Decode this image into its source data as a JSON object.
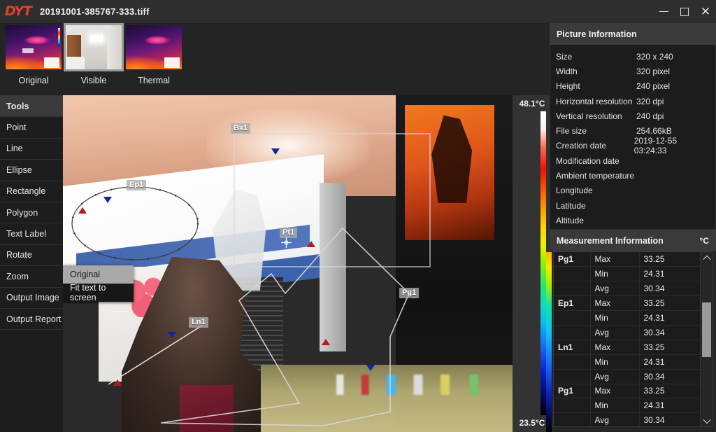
{
  "titlebar": {
    "logo": "DYT",
    "filename": "20191001-385767-333.tiff",
    "minimize": "minimize-button",
    "maximize": "maximize-button",
    "close": "close-button"
  },
  "thumbnails": [
    {
      "label": "Original",
      "selected": false,
      "kind": "thermal"
    },
    {
      "label": "Visible",
      "selected": true,
      "kind": "visible"
    },
    {
      "label": "Thermal",
      "selected": false,
      "kind": "thermal"
    }
  ],
  "tools": {
    "header": "Tools",
    "items": [
      "Point",
      "Line",
      "Ellipse",
      "Rectangle",
      "Polygon",
      "Text Label",
      "Rotate",
      "Zoom",
      "Output Image",
      "Output Report"
    ]
  },
  "zoom_menu": {
    "options": [
      "Original",
      "Fit text to screen"
    ],
    "selected": "Original"
  },
  "canvas": {
    "temp_max": "48.1°C",
    "temp_min": "23.5°C",
    "annotations": [
      {
        "name": "Bx1",
        "type": "rectangle"
      },
      {
        "name": "Ep1",
        "type": "ellipse"
      },
      {
        "name": "Pt1",
        "type": "point"
      },
      {
        "name": "Ln1",
        "type": "line"
      },
      {
        "name": "Pg1",
        "type": "polygon"
      }
    ]
  },
  "picture_information": {
    "title": "Picture Information",
    "rows": [
      {
        "key": "Size",
        "value": "320 x 240"
      },
      {
        "key": "Width",
        "value": "320 pixel"
      },
      {
        "key": "Height",
        "value": "240 pixel"
      },
      {
        "key": "Horizontal resolution",
        "value": "320 dpi"
      },
      {
        "key": "Vertical resolution",
        "value": "240 dpi"
      },
      {
        "key": "File size",
        "value": "254.66kB"
      },
      {
        "key": "Creation date",
        "value": "2019-12-55 03:24:33"
      },
      {
        "key": "Modification date",
        "value": ""
      },
      {
        "key": "Ambient temperature",
        "value": ""
      },
      {
        "key": "Longitude",
        "value": ""
      },
      {
        "key": "Latitude",
        "value": ""
      },
      {
        "key": "Altitude",
        "value": ""
      }
    ]
  },
  "measurement_information": {
    "title": "Measurement Information",
    "unit": "°C",
    "rows": [
      {
        "name": "Pg1",
        "stat": "Max",
        "value": "33.25"
      },
      {
        "name": "",
        "stat": "Min",
        "value": "24.31"
      },
      {
        "name": "",
        "stat": "Avg",
        "value": "30.34"
      },
      {
        "name": "Ep1",
        "stat": "Max",
        "value": "33.25"
      },
      {
        "name": "",
        "stat": "Min",
        "value": "24.31"
      },
      {
        "name": "",
        "stat": "Avg",
        "value": "30.34"
      },
      {
        "name": "Ln1",
        "stat": "Max",
        "value": "33.25"
      },
      {
        "name": "",
        "stat": "Min",
        "value": "24.31"
      },
      {
        "name": "",
        "stat": "Avg",
        "value": "30.34"
      },
      {
        "name": "Pg1",
        "stat": "Max",
        "value": "33.25"
      },
      {
        "name": "",
        "stat": "Min",
        "value": "24.31"
      },
      {
        "name": "",
        "stat": "Avg",
        "value": "30.34"
      }
    ]
  },
  "colors": {
    "accent": "#d8412f",
    "panel_header": "#3a3a3a",
    "panel_body": "#1c1c1c",
    "window_bg": "#2b2b2b",
    "marker_hot": "#b21b1b",
    "marker_cold": "#14239e"
  }
}
